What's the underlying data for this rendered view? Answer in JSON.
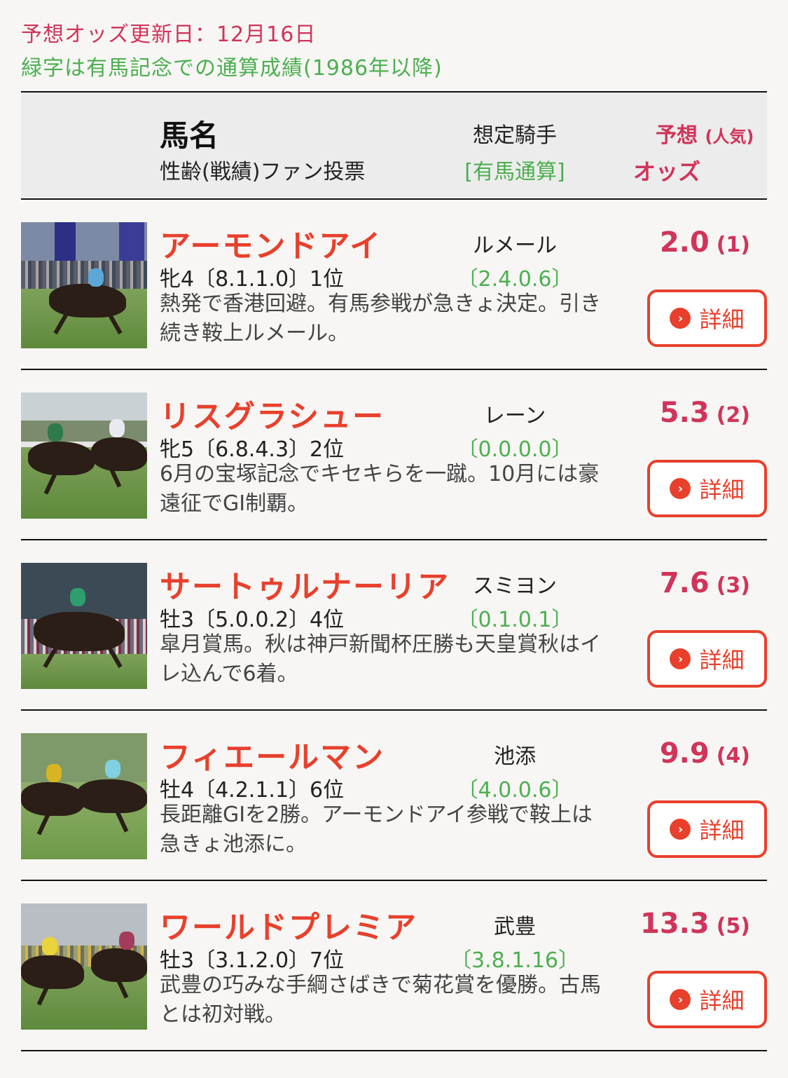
{
  "top": {
    "update_line": "予想オッズ更新日：12月16日",
    "green_note": "緑字は有馬記念での通算成績(1986年以降)"
  },
  "header": {
    "name_label": "馬名",
    "sub_label": "性齢(戦績)ファン投票",
    "jockey_label": "想定騎手",
    "jockey_sub_label": "[有馬通算]",
    "pred_label": "予想",
    "pop_label": "(人気)",
    "odds_label": "オッズ"
  },
  "colors": {
    "accent_red": "#e8402c",
    "pink": "#d0345a",
    "green": "#4caf50"
  },
  "icons": {
    "detail_button": "chevron-right-circle-icon"
  },
  "horses": [
    {
      "name": "アーモンドアイ",
      "record": "牝4〔8.1.1.0〕1位",
      "jockey": "ルメール",
      "jockey_stat": "〔2.4.0.6〕",
      "odds": "2.0",
      "popularity": "(1)",
      "comment": "熱発で香港回避。有馬参戦が急きょ決定。引き続き鞍上ルメール。",
      "button": "詳細"
    },
    {
      "name": "リスグラシュー",
      "record": "牝5〔6.8.4.3〕2位",
      "jockey": "レーン",
      "jockey_stat": "〔0.0.0.0〕",
      "odds": "5.3",
      "popularity": "(2)",
      "comment": "6月の宝塚記念でキセキらを一蹴。10月には豪遠征でGI制覇。",
      "button": "詳細"
    },
    {
      "name": "サートゥルナーリア",
      "record": "牡3〔5.0.0.2〕4位",
      "jockey": "スミヨン",
      "jockey_stat": "〔0.1.0.1〕",
      "odds": "7.6",
      "popularity": "(3)",
      "comment": "皐月賞馬。秋は神戸新聞杯圧勝も天皇賞秋はイレ込んで6着。",
      "button": "詳細"
    },
    {
      "name": "フィエールマン",
      "record": "牡4〔4.2.1.1〕6位",
      "jockey": "池添",
      "jockey_stat": "〔4.0.0.6〕",
      "odds": "9.9",
      "popularity": "(4)",
      "comment": "長距離GIを2勝。アーモンドアイ参戦で鞍上は急きょ池添に。",
      "button": "詳細"
    },
    {
      "name": "ワールドプレミア",
      "record": "牡3〔3.1.2.0〕7位",
      "jockey": "武豊",
      "jockey_stat": "〔3.8.1.16〕",
      "odds": "13.3",
      "popularity": "(5)",
      "comment": "武豊の巧みな手綱さばきで菊花賞を優勝。古馬とは初対戦。",
      "button": "詳細"
    }
  ]
}
